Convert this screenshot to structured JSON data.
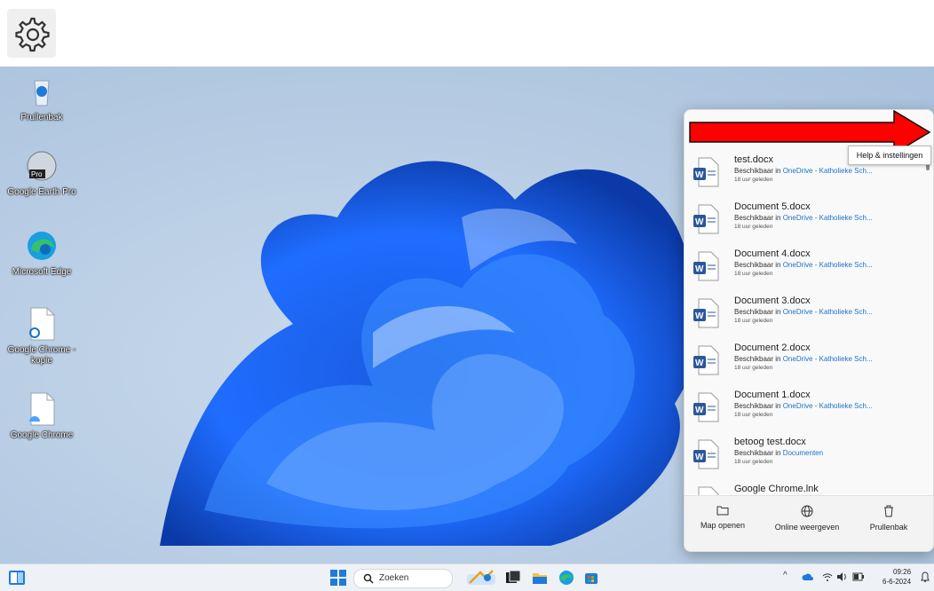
{
  "top_caption": {
    "part1": "",
    "part2": ""
  },
  "desktop_icons": [
    {
      "label": "Prullenbak",
      "icon": "recycle-bin-icon"
    },
    {
      "label": "Google Earth Pro",
      "icon": "google-earth-icon"
    },
    {
      "label": "Microsoft Edge",
      "icon": "edge-icon"
    },
    {
      "label": "Google Chrome - kopie",
      "icon": "file-icon"
    },
    {
      "label": "Google Chrome",
      "icon": "file-icon"
    }
  ],
  "tooltip": "Help & instellingen",
  "files": [
    {
      "name": "test.docx",
      "prefix": "Beschikbaar in ",
      "location": "OneDrive - Katholieke Sch...",
      "time": "18 uur geleden"
    },
    {
      "name": "Document 5.docx",
      "prefix": "Beschikbaar in ",
      "location": "OneDrive - Katholieke Sch...",
      "time": "18 uur geleden"
    },
    {
      "name": "Document 4.docx",
      "prefix": "Beschikbaar in ",
      "location": "OneDrive - Katholieke Sch...",
      "time": "18 uur geleden"
    },
    {
      "name": "Document 3.docx",
      "prefix": "Beschikbaar in ",
      "location": "OneDrive - Katholieke Sch...",
      "time": "18 uur geleden"
    },
    {
      "name": "Document 2.docx",
      "prefix": "Beschikbaar in ",
      "location": "OneDrive - Katholieke Sch...",
      "time": "18 uur geleden"
    },
    {
      "name": "Document 1.docx",
      "prefix": "Beschikbaar in ",
      "location": "OneDrive - Katholieke Sch...",
      "time": "18 uur geleden"
    },
    {
      "name": "betoog test.docx",
      "prefix": "Beschikbaar in ",
      "location": "Documenten",
      "time": "18 uur geleden"
    },
    {
      "name": "Google Chrome.lnk",
      "prefix": "",
      "location": "",
      "time": ""
    }
  ],
  "footer": {
    "open_folder": "Map openen",
    "view_online": "Online weergeven",
    "recycle_bin": "Prullenbak"
  },
  "taskbar": {
    "search_label": "Zoeken",
    "time": "09:26",
    "date": "6-6-2024"
  },
  "colors": {
    "accent": "#1a73c9",
    "arrow": "#ff0000",
    "word_blue": "#2b579a"
  }
}
